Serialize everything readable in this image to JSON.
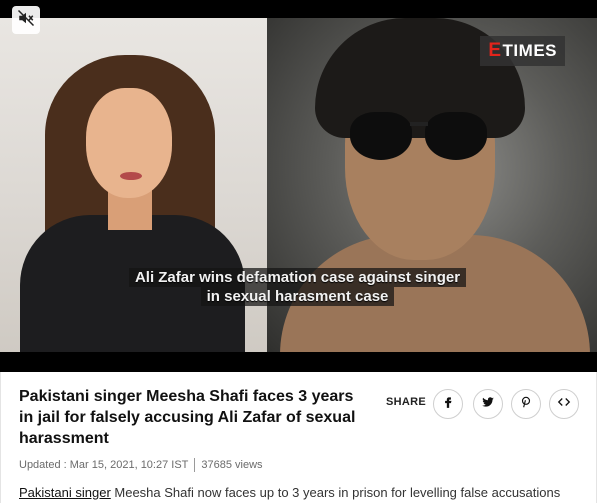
{
  "video": {
    "brand_prefix": "E",
    "brand_suffix": "TIMES",
    "caption_line1": "Ali Zafar wins defamation case against singer",
    "caption_line2": "in sexual harasment case",
    "mute_icon": "speaker-muted-icon"
  },
  "article": {
    "title": "Pakistani singer Meesha Shafi faces 3 years in jail for falsely accusing Ali Zafar of sexual harassment",
    "updated": "Updated : Mar 15, 2021, 10:27 IST",
    "views": "37685 views",
    "lead_link": "Pakistani singer",
    "lead_text": " Meesha Shafi now faces up to 3 years in prison for levelling false accusations"
  },
  "share": {
    "label": "SHARE",
    "buttons": [
      {
        "icon": "facebook-icon"
      },
      {
        "icon": "twitter-icon"
      },
      {
        "icon": "pinterest-icon"
      },
      {
        "icon": "embed-code-icon"
      }
    ]
  }
}
